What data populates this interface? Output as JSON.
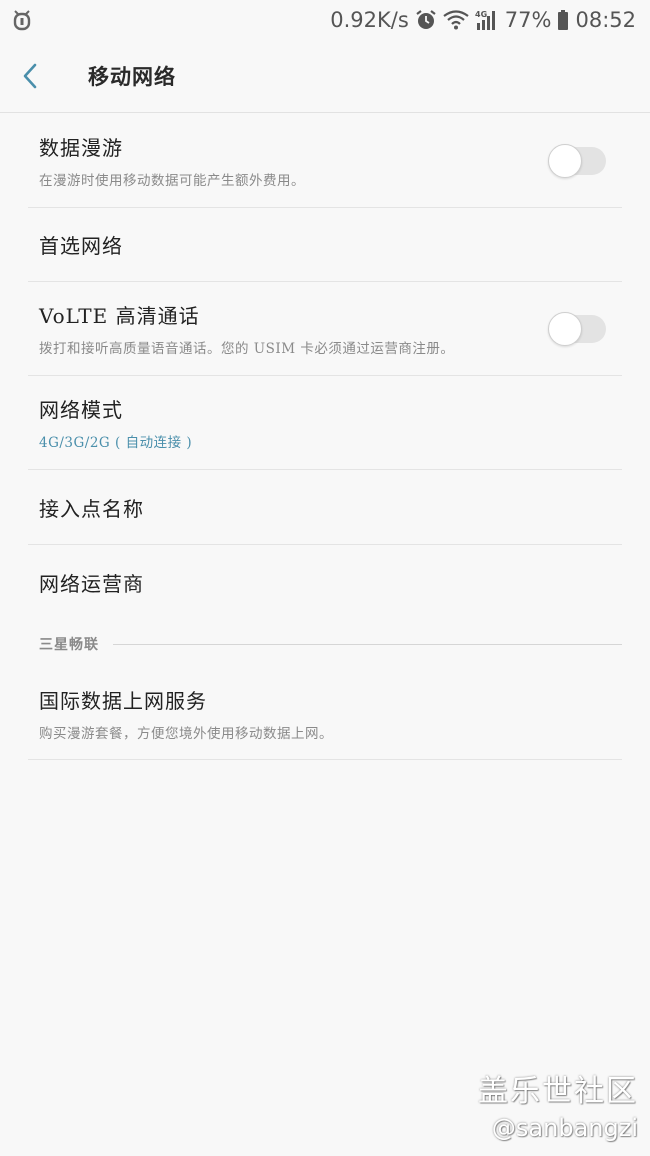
{
  "status_bar": {
    "net_speed": "0.92K/s",
    "battery": "77%",
    "time": "08:52",
    "network_type": "4G",
    "icons": [
      "notification-bug-icon",
      "alarm-icon",
      "wifi-icon",
      "signal-icon",
      "battery-icon"
    ]
  },
  "header": {
    "title": "移动网络",
    "back_icon": "chevron-left-icon"
  },
  "items": {
    "roaming": {
      "title": "数据漫游",
      "subtitle": "在漫游时使用移动数据可能产生额外费用。",
      "toggle_on": false
    },
    "preferred_network": {
      "title": "首选网络"
    },
    "volte": {
      "title": "VoLTE 高清通话",
      "subtitle": "拨打和接听高质量语音通话。您的 USIM 卡必须通过运营商注册。",
      "toggle_on": false
    },
    "network_mode": {
      "title": "网络模式",
      "subtitle": "4G/3G/2G ( 自动连接 )"
    },
    "apn": {
      "title": "接入点名称"
    },
    "operators": {
      "title": "网络运营商"
    }
  },
  "section": {
    "label": "三星畅联"
  },
  "intl_data": {
    "title": "国际数据上网服务",
    "subtitle": "购买漫游套餐，方便您境外使用移动数据上网。"
  },
  "watermark": {
    "line1": "盖乐世社区",
    "line2": "@sanbangzi"
  },
  "colors": {
    "accent": "#4a8fab",
    "background": "#f8f8f8",
    "divider": "#e4e4e4"
  }
}
